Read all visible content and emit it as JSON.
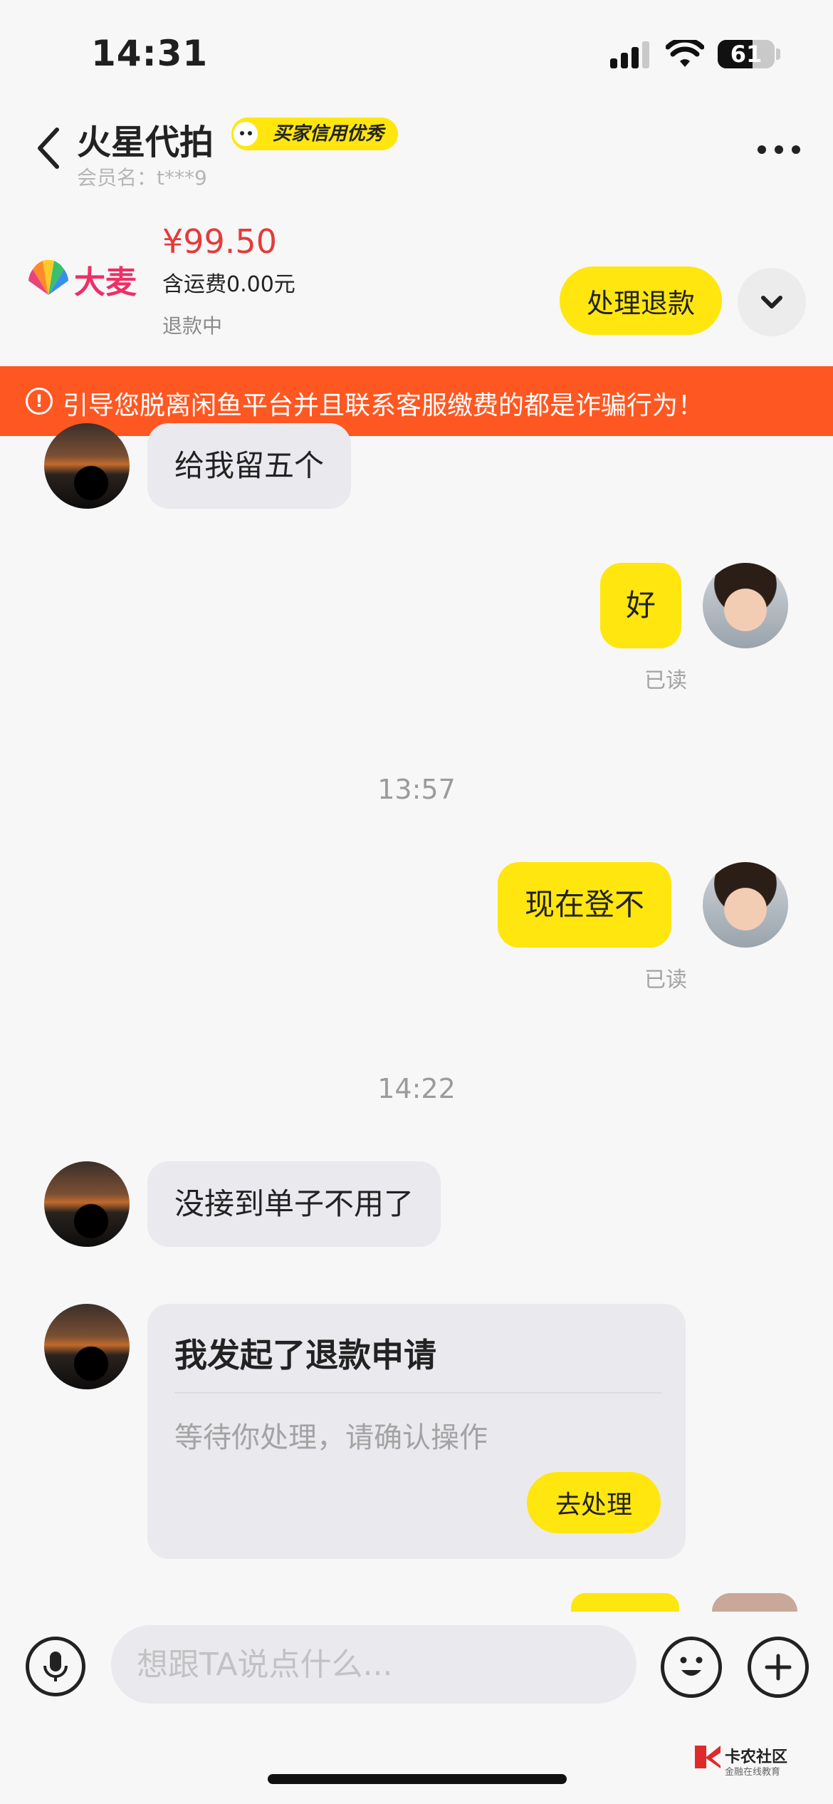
{
  "status_bar": {
    "time": "14:31",
    "battery": "61"
  },
  "header": {
    "seller_name": "火星代拍",
    "credit_badge": "买家信用优秀",
    "member_label": "会员名：t***9"
  },
  "product": {
    "brand": "大麦",
    "price": "¥99.50",
    "shipping": "含运费0.00元",
    "status": "退款中",
    "action_label": "处理退款"
  },
  "warning": {
    "icon": "exclamation-circle-icon",
    "text": "引导您脱离闲鱼平台并且联系客服缴费的都是诈骗行为！",
    "color": "#ff5722"
  },
  "chat": {
    "messages": [
      {
        "from": "buyer",
        "text": "给我留五个"
      },
      {
        "from": "me",
        "text": "好",
        "read": "已读"
      },
      {
        "time": "13:57"
      },
      {
        "from": "me",
        "text": "现在登不",
        "read": "已读"
      },
      {
        "time": "14:22"
      },
      {
        "from": "buyer",
        "text": "没接到单子不用了"
      }
    ],
    "refund_card": {
      "title": "我发起了退款申请",
      "desc": "等待你处理，请确认操作",
      "button": "去处理"
    }
  },
  "input": {
    "placeholder": "想跟TA说点什么..."
  },
  "watermark": {
    "title": "卡农社区",
    "sub": "金融在线教育"
  },
  "colors": {
    "accent": "#ffe60f",
    "price": "#e43b3b",
    "bubble_in": "#e9e9ee"
  }
}
